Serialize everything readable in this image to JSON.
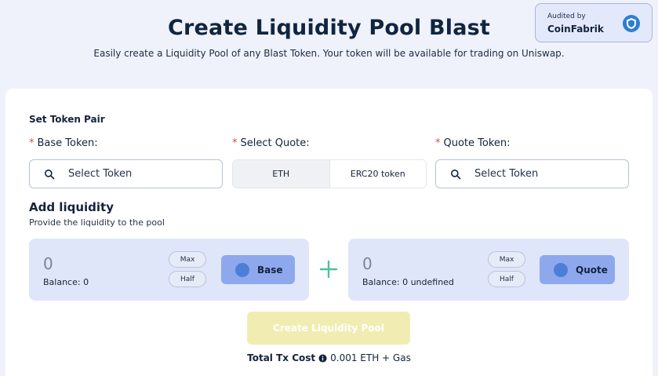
{
  "header": {
    "title": "Create Liquidity Pool Blast",
    "subtitle": "Easily create a Liquidity Pool of any Blast Token. Your token will be available for trading on Uniswap."
  },
  "audit": {
    "label": "Audited by",
    "brand": "CoinFabrik",
    "icon": "shield-icon"
  },
  "token_pair": {
    "section_label": "Set Token Pair",
    "required_mark": "*",
    "base": {
      "label": "Base Token:",
      "placeholder": "Select Token"
    },
    "quote_select": {
      "label": "Select Quote:",
      "options": [
        "ETH",
        "ERC20 token"
      ],
      "selected": "ETH"
    },
    "quote": {
      "label": "Quote Token:",
      "placeholder": "Select Token"
    }
  },
  "liquidity": {
    "title": "Add liquidity",
    "subtitle": "Provide the liquidity to the pool",
    "base_panel": {
      "amount": "0",
      "balance": "Balance: 0",
      "max": "Max",
      "half": "Half",
      "token_label": "Base"
    },
    "quote_panel": {
      "amount": "0",
      "balance": "Balance: 0 undefined",
      "max": "Max",
      "half": "Half",
      "token_label": "Quote"
    }
  },
  "create_button": "Create Liquidity Pool",
  "total_cost": {
    "label": "Total Tx Cost",
    "value": "0.001 ETH + Gas"
  },
  "colors": {
    "background": "#f0f2fb",
    "panel": "#dfe6f9",
    "token_button": "#8ea8ee",
    "token_dot": "#4e7fd6",
    "create_button": "#f1edb2",
    "required": "#e04848",
    "plus": "#4fbfa0"
  }
}
